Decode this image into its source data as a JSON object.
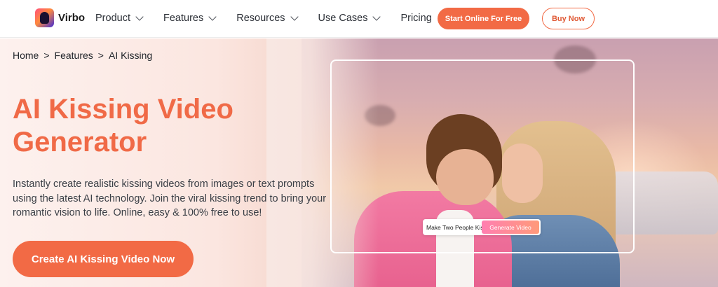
{
  "nav": {
    "brand": "Virbo",
    "items": [
      {
        "label": "Product",
        "has_dropdown": true
      },
      {
        "label": "Features",
        "has_dropdown": true
      },
      {
        "label": "Resources",
        "has_dropdown": true
      },
      {
        "label": "Use Cases",
        "has_dropdown": true
      },
      {
        "label": "Pricing",
        "has_dropdown": false
      }
    ],
    "start_button": "Start Online For Free",
    "buy_button": "Buy Now"
  },
  "breadcrumb": {
    "items": [
      "Home",
      "Features",
      "AI Kissing"
    ],
    "separator": ">"
  },
  "hero": {
    "title_line1": "AI Kissing Video",
    "title_line2": "Generator",
    "description": "Instantly create realistic kissing videos from images or text prompts using the latest AI technology. Join the viral kissing trend to bring your romantic vision to life. Online, easy & 100% free to use!",
    "cta_label": "Create AI Kissing Video Now"
  },
  "demo": {
    "prompt_text": "Make Two People Kiss",
    "generate_label": "Generate Video"
  },
  "colors": {
    "accent": "#f26a45",
    "title": "#f06a47"
  }
}
